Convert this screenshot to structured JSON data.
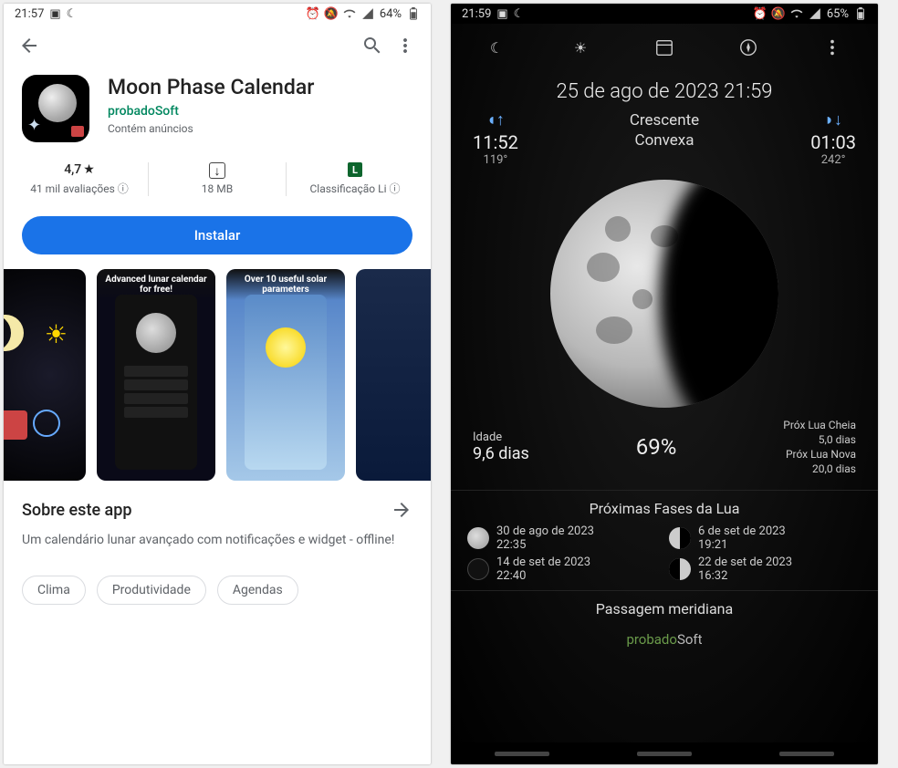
{
  "left": {
    "status": {
      "time": "21:57",
      "battery": "64%"
    },
    "app": {
      "title": "Moon Phase Calendar",
      "developer": "probadoSoft",
      "ads": "Contém anúncios"
    },
    "stats": {
      "rating": "4,7",
      "reviews_label": "41 mil avaliações",
      "size": "18 MB",
      "rating_letter": "L",
      "rating_label": "Classificação Li"
    },
    "install": "Instalar",
    "screenshots": {
      "s2_banner": "Advanced lunar calendar for free!",
      "s3_banner": "Over 10 useful solar parameters"
    },
    "about": {
      "title": "Sobre este app",
      "desc": "Um calendário lunar avançado com notificações e widget - offline!"
    },
    "tags": [
      "Clima",
      "Produtividade",
      "Agendas"
    ]
  },
  "right": {
    "status": {
      "time": "21:59",
      "battery": "65%"
    },
    "date": "25 de ago de 2023 21:59",
    "phase_name_l1": "Crescente",
    "phase_name_l2": "Convexa",
    "rise": {
      "time": "11:52",
      "deg": "119°"
    },
    "set": {
      "time": "01:03",
      "deg": "242°"
    },
    "age_label": "Idade",
    "age_value": "9,6 dias",
    "illum": "69%",
    "next_full_label": "Próx Lua Cheia",
    "next_full_value": "5,0 dias",
    "next_new_label": "Próx Lua Nova",
    "next_new_value": "20,0 dias",
    "phases_title": "Próximas Fases da Lua",
    "phases": [
      {
        "date": "30 de ago de 2023",
        "time": "22:35"
      },
      {
        "date": "6 de set de 2023",
        "time": "19:21"
      },
      {
        "date": "14 de set de 2023",
        "time": "22:40"
      },
      {
        "date": "22 de set de 2023",
        "time": "16:32"
      }
    ],
    "meridian": "Passagem meridiana",
    "brand_p": "probado",
    "brand_s": "Soft"
  }
}
